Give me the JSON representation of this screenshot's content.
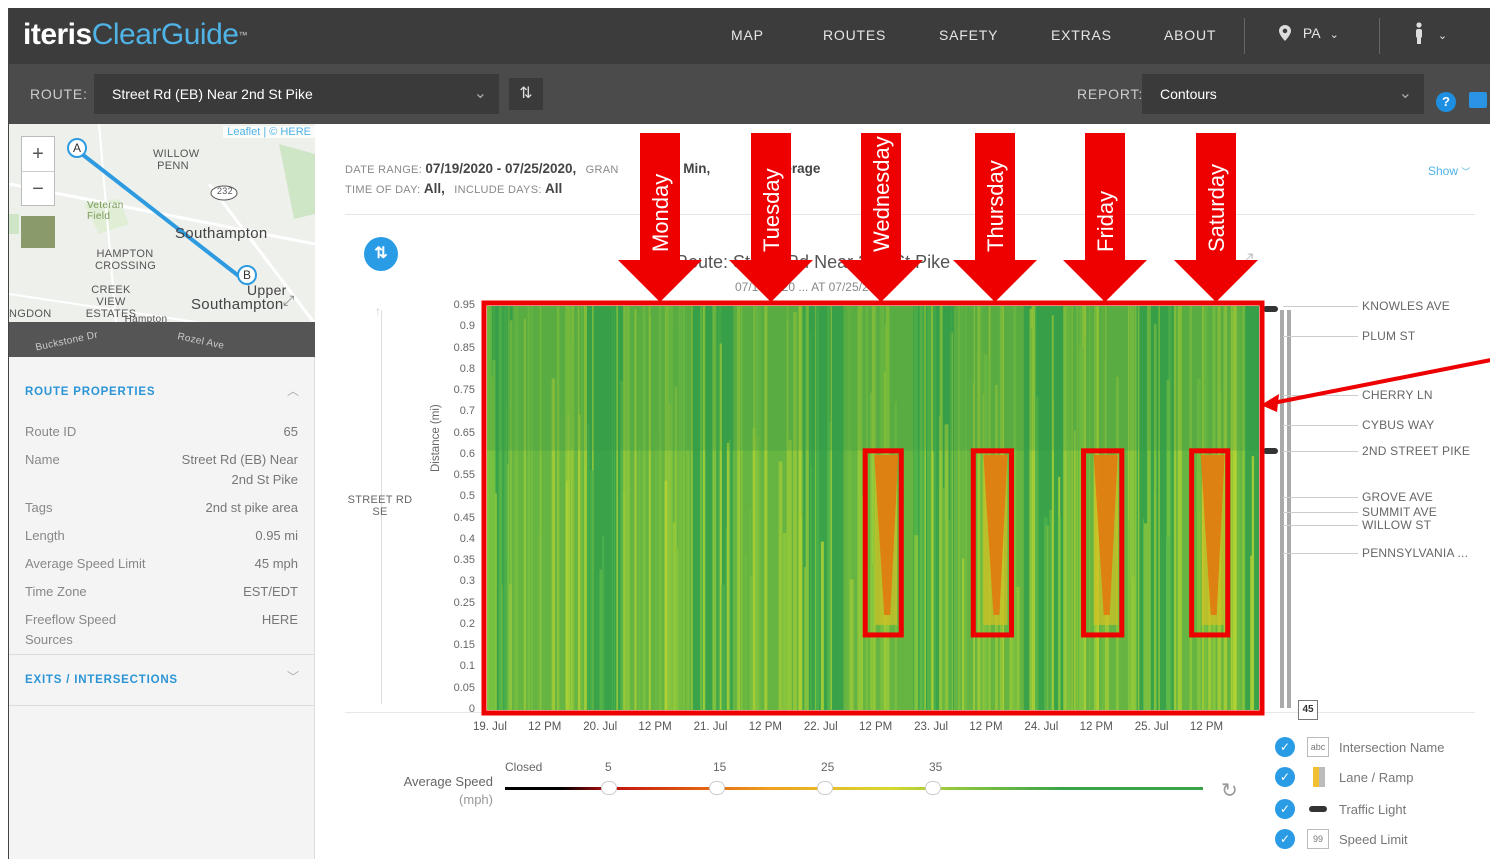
{
  "app": {
    "logo_main": "iteris",
    "logo_accent": "ClearGuide",
    "logo_tm": "™"
  },
  "nav": {
    "items": [
      "MAP",
      "ROUTES",
      "SAFETY",
      "EXTRAS",
      "ABOUT"
    ],
    "state": "PA"
  },
  "routebar": {
    "route_label": "ROUTE:",
    "route_value": "Street Rd (EB) Near 2nd St Pike",
    "report_label": "REPORT:",
    "report_value": "Contours"
  },
  "map": {
    "attribution": "Leaflet | © HERE",
    "places": [
      "WILLOW PENN",
      "232",
      "Veteran Field",
      "Southampton",
      "HAMPTON CROSSING",
      "CREEK VIEW ESTATES",
      "Southampton",
      "Upper",
      "NGDON",
      "Hampton Square",
      "Buckstone Dr",
      "Rozel Ave"
    ],
    "marker_a": "A",
    "marker_b": "B"
  },
  "route_properties": {
    "heading": "ROUTE PROPERTIES",
    "rows": [
      {
        "label": "Route ID",
        "value": "65"
      },
      {
        "label": "Name",
        "value": "Street Rd (EB) Near 2nd St Pike"
      },
      {
        "label": "Tags",
        "value": "2nd st pike area"
      },
      {
        "label": "Length",
        "value": "0.95 mi"
      },
      {
        "label": "Average Speed Limit",
        "value": "45 mph"
      },
      {
        "label": "Time Zone",
        "value": "EST/EDT"
      },
      {
        "label": "Freeflow Speed Sources",
        "value": "HERE"
      }
    ]
  },
  "exits": {
    "heading": "EXITS / INTERSECTIONS"
  },
  "report_meta": {
    "date_range_label": "DATE RANGE:",
    "date_range_value": "07/19/2020 - 07/25/2020,",
    "gran_label": "GRAN",
    "gran_value": "5 Min,",
    "average": "Average",
    "tod_label": "TIME OF DAY:",
    "tod_value": "All,",
    "days_label": "INCLUDE DAYS:",
    "days_value": "All",
    "show": "Show"
  },
  "chart_title": "Route: Street Rd Near 2nd St Pike",
  "chart_subtitle": "07/19/2020 ... AT 07/25/2020",
  "street_label": "STREET RD SE",
  "annotations": {
    "days": [
      "Monday",
      "Tuesday",
      "Wednesday",
      "Thursday",
      "Friday",
      "Saturday"
    ]
  },
  "chart_data": {
    "type": "heatmap",
    "xlabel": "",
    "ylabel": "Distance (mi)",
    "x_ticks": [
      "19. Jul",
      "12 PM",
      "20. Jul",
      "12 PM",
      "21. Jul",
      "12 PM",
      "22. Jul",
      "12 PM",
      "23. Jul",
      "12 PM",
      "24. Jul",
      "12 PM",
      "25. Jul",
      "12 PM"
    ],
    "y_ticks": [
      0.95,
      0.9,
      0.85,
      0.8,
      0.75,
      0.7,
      0.65,
      0.6,
      0.55,
      0.5,
      0.45,
      0.4,
      0.35,
      0.3,
      0.25,
      0.2,
      0.15,
      0.1,
      0.05,
      0
    ],
    "ylim": [
      0,
      0.95
    ],
    "speed_colorbar": {
      "label": "Average Speed",
      "unit": "(mph)",
      "ticks": [
        "Closed",
        "5",
        "15",
        "25",
        "35"
      ]
    },
    "congestion": [
      {
        "day": "Wednesday",
        "x_days": [
          3.52,
          3.72
        ],
        "y_mi": [
          0.2,
          0.6
        ]
      },
      {
        "day": "Thursday",
        "x_days": [
          4.5,
          4.72
        ],
        "y_mi": [
          0.2,
          0.6
        ]
      },
      {
        "day": "Friday",
        "x_days": [
          5.5,
          5.72
        ],
        "y_mi": [
          0.2,
          0.6
        ]
      },
      {
        "day": "Saturday",
        "x_days": [
          6.48,
          6.68
        ],
        "y_mi": [
          0.2,
          0.6
        ]
      }
    ]
  },
  "landmarks": [
    "KNOWLES AVE",
    "PLUM ST",
    "CHERRY LN",
    "CYBUS WAY",
    "2ND STREET PIKE",
    "GROVE AVE",
    "SUMMIT AVE",
    "WILLOW ST",
    "PENNSYLVANIA ..."
  ],
  "speed_limit_badge": "45",
  "legend": [
    {
      "label": "Intersection Name",
      "icon": "abc"
    },
    {
      "label": "Lane / Ramp",
      "icon": ""
    },
    {
      "label": "Traffic Light",
      "icon": ""
    },
    {
      "label": "Speed Limit",
      "icon": "99"
    }
  ],
  "colors": {
    "accent": "#2b95d6",
    "annotation": "#ee0000",
    "free": "#3aa34a",
    "slow": "#e07a10"
  }
}
